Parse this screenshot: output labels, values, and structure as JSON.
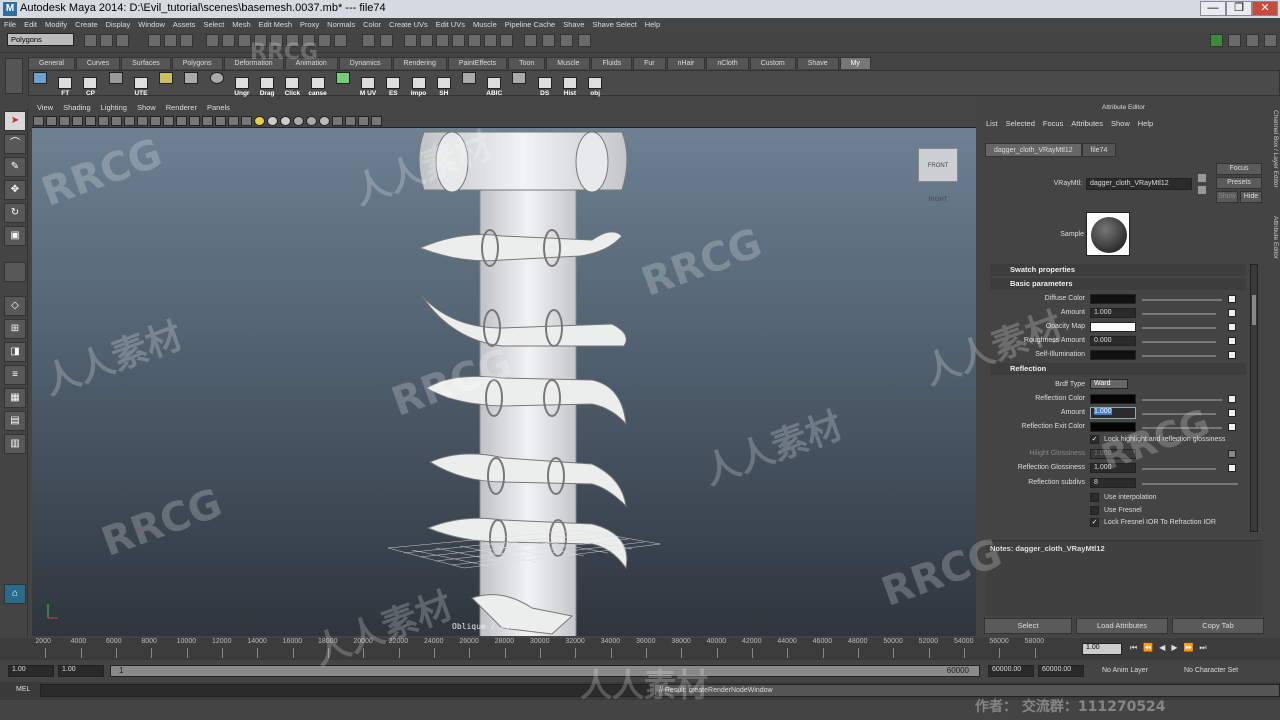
{
  "title": "Autodesk Maya 2014: D:\\Evil_tutorial\\scenes\\basemesh.0037.mb*  ---  file74",
  "window_controls": [
    "—",
    "❐",
    "✕"
  ],
  "menubar": [
    "File",
    "Edit",
    "Modify",
    "Create",
    "Display",
    "Window",
    "Assets",
    "Select",
    "Mesh",
    "Edit Mesh",
    "Proxy",
    "Normals",
    "Color",
    "Create UVs",
    "Edit UVs",
    "Muscle",
    "Pipeline Cache",
    "Shave",
    "Shave Select",
    "Help"
  ],
  "mode": "Polygons",
  "shelf_tabs": [
    "General",
    "Curves",
    "Surfaces",
    "Polygons",
    "Deformation",
    "Animation",
    "Dynamics",
    "Rendering",
    "PaintEffects",
    "Toon",
    "Muscle",
    "Fluids",
    "Fur",
    "nHair",
    "nCloth",
    "Custom",
    "Shave",
    "My"
  ],
  "shelf_active": "My",
  "shelf_items": [
    "",
    "FT",
    "CP",
    "",
    "UTE",
    "",
    "",
    "",
    "Ungr",
    "Drag",
    "Click",
    "canse",
    "",
    "M UV",
    "ES",
    "Impo",
    "SH",
    "",
    "ABIC",
    "",
    "DS",
    "Hist",
    "obj"
  ],
  "viewport": {
    "menu": [
      "View",
      "Shading",
      "Lighting",
      "Show",
      "Renderer",
      "Panels"
    ],
    "viewcube_front": "FRONT",
    "viewcube_right": "RIGHT",
    "hud": "Oblique / Zoom : persp"
  },
  "attribute_editor": {
    "title": "Attribute Editor",
    "menu": [
      "List",
      "Selected",
      "Focus",
      "Attributes",
      "Show",
      "Help"
    ],
    "tabs": [
      "dagger_cloth_VRayMtl12",
      "file74"
    ],
    "active_tab": "dagger_cloth_VRayMtl12",
    "right_buttons": [
      "Focus",
      "Presets",
      "Show",
      "Hide"
    ],
    "vraymtl_label": "VRayMtl:",
    "vraymtl_value": "dagger_cloth_VRayMtl12",
    "sample_label": "Sample",
    "sections": {
      "swatch": "Swatch properties",
      "basic": "Basic parameters",
      "reflection": "Reflection"
    },
    "basic": [
      {
        "label": "Diffuse Color",
        "value": ""
      },
      {
        "label": "Amount",
        "value": "1.000"
      },
      {
        "label": "Opacity Map",
        "value": ""
      },
      {
        "label": "Roughness Amount",
        "value": "0.000"
      },
      {
        "label": "Self-Illumination",
        "value": ""
      }
    ],
    "reflection": {
      "brdf_label": "Brdf Type",
      "brdf_value": "Ward",
      "refl_color": "Reflection Color",
      "amount_label": "Amount",
      "amount_value": "1.000",
      "exit_color": "Reflection Exit Color",
      "lock_highlight": "Lock highlight and reflection glossiness",
      "hilight_label": "Hilight Glossiness",
      "hilight_value": "1.000",
      "gloss_label": "Reflection Glossiness",
      "gloss_value": "1.000",
      "subdivs_label": "Reflection subdivs",
      "subdivs_value": "8",
      "use_interp": "Use interpolation",
      "use_fresnel": "Use Fresnel",
      "lock_fresnel": "Lock Fresnel IOR To Refraction IOR"
    },
    "notes": "Notes:  dagger_cloth_VRayMtl12",
    "bottom_buttons": [
      "Select",
      "Load Attributes",
      "Copy Tab"
    ]
  },
  "side_tabs": [
    "Channel Box / Layer Editor",
    "Attribute Editor"
  ],
  "timeline": {
    "ticks": [
      "2000",
      "4000",
      "6000",
      "8000",
      "10000",
      "12000",
      "14000",
      "16000",
      "18000",
      "20000",
      "22000",
      "24000",
      "26000",
      "28000",
      "30000",
      "32000",
      "34000",
      "36000",
      "38000",
      "40000",
      "42000",
      "44000",
      "46000",
      "48000",
      "50000",
      "52000",
      "54000",
      "56000",
      "58000"
    ],
    "current": "1.00"
  },
  "range": {
    "start": "1.00",
    "inner_start": "1.00",
    "range_start_label": "1",
    "range_end_label": "60000",
    "end": "60000.00",
    "end2": "60000.00",
    "anim_layer": "No Anim Layer",
    "char_set": "No Character Set"
  },
  "cmdline": {
    "lang": "MEL",
    "result": "// Result: createRenderNodeWindow"
  },
  "watermarks": [
    "RRCG",
    "人人素材",
    "RRCG",
    "人人素材",
    "RRCG",
    "人人素材",
    "RRCG",
    "人人素材",
    "RRCG",
    "人人素材",
    "RRCG",
    "人人素材",
    "RRCG"
  ],
  "footer_credit": "作者：  交流群：111270524",
  "colors": {
    "accent": "#3a6e9e",
    "viewport_top": "#6d8192",
    "viewport_bottom": "#2e353d",
    "selection": "#4a7cc0"
  }
}
